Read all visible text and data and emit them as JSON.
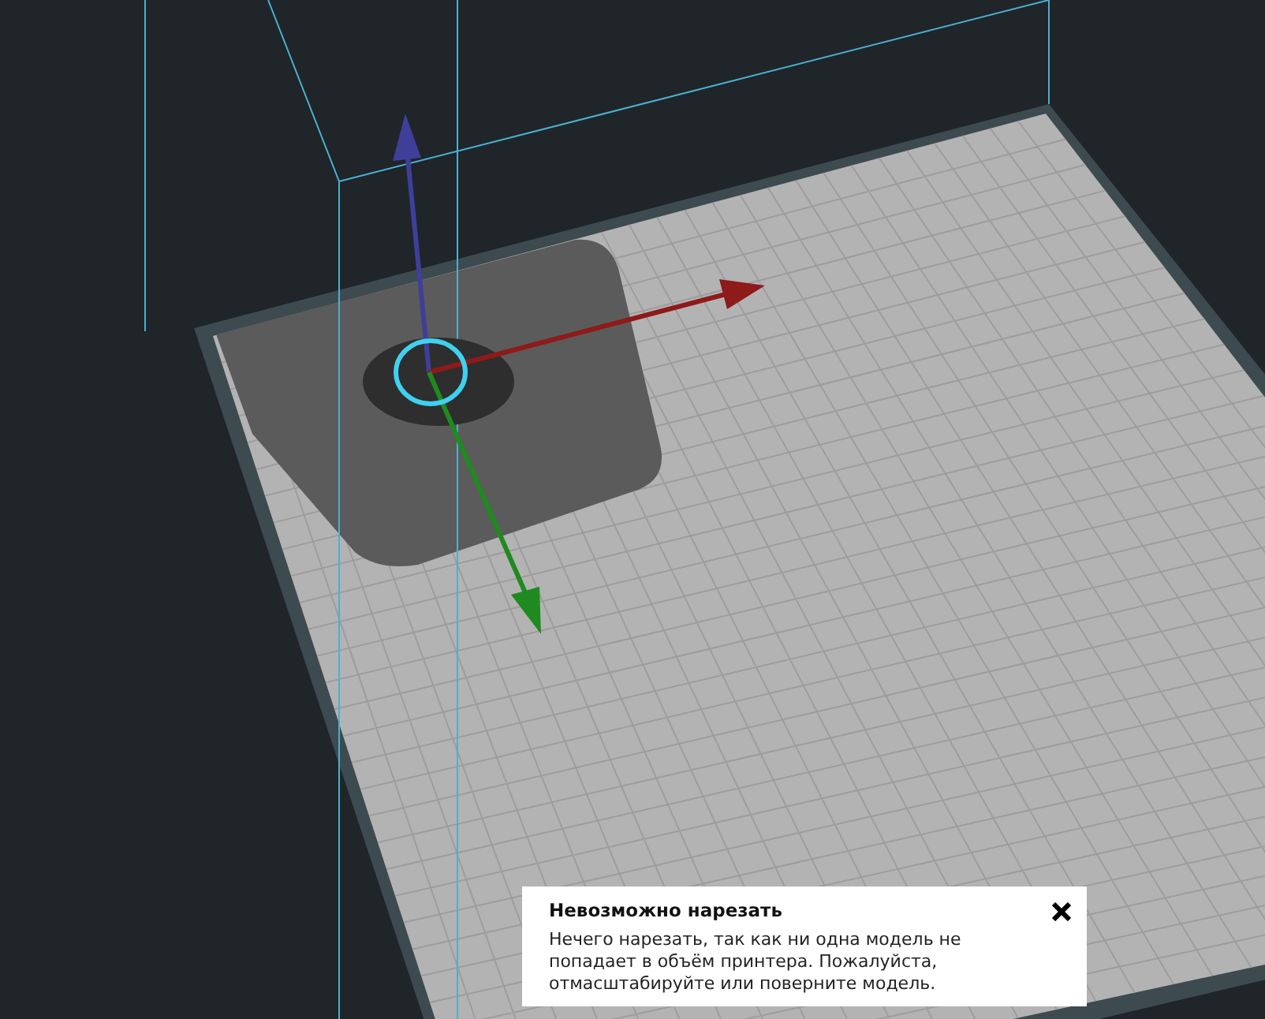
{
  "notification": {
    "title": "Невозможно нарезать",
    "message": "Нечего нарезать, так как ни одна модель не попадает в объём принтера. Пожалуйста, отмасштабируйте или поверните модель."
  }
}
